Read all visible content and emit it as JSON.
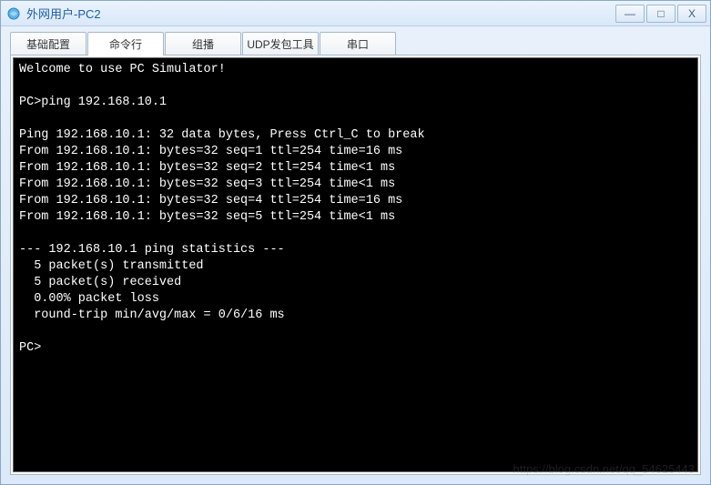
{
  "window": {
    "title": "外网用户-PC2"
  },
  "tabs": [
    {
      "label": "基础配置"
    },
    {
      "label": "命令行"
    },
    {
      "label": "组播"
    },
    {
      "label": "UDP发包工具"
    },
    {
      "label": "串口"
    }
  ],
  "terminal": {
    "lines": [
      "Welcome to use PC Simulator!",
      "",
      "PC>ping 192.168.10.1",
      "",
      "Ping 192.168.10.1: 32 data bytes, Press Ctrl_C to break",
      "From 192.168.10.1: bytes=32 seq=1 ttl=254 time=16 ms",
      "From 192.168.10.1: bytes=32 seq=2 ttl=254 time<1 ms",
      "From 192.168.10.1: bytes=32 seq=3 ttl=254 time<1 ms",
      "From 192.168.10.1: bytes=32 seq=4 ttl=254 time=16 ms",
      "From 192.168.10.1: bytes=32 seq=5 ttl=254 time<1 ms",
      "",
      "--- 192.168.10.1 ping statistics ---",
      "  5 packet(s) transmitted",
      "  5 packet(s) received",
      "  0.00% packet loss",
      "  round-trip min/avg/max = 0/6/16 ms",
      "",
      "PC>"
    ]
  },
  "controls": {
    "minimize": "—",
    "maximize": "□",
    "close": "X"
  },
  "watermark": "https://blog.csdn.net/qq_54625443"
}
